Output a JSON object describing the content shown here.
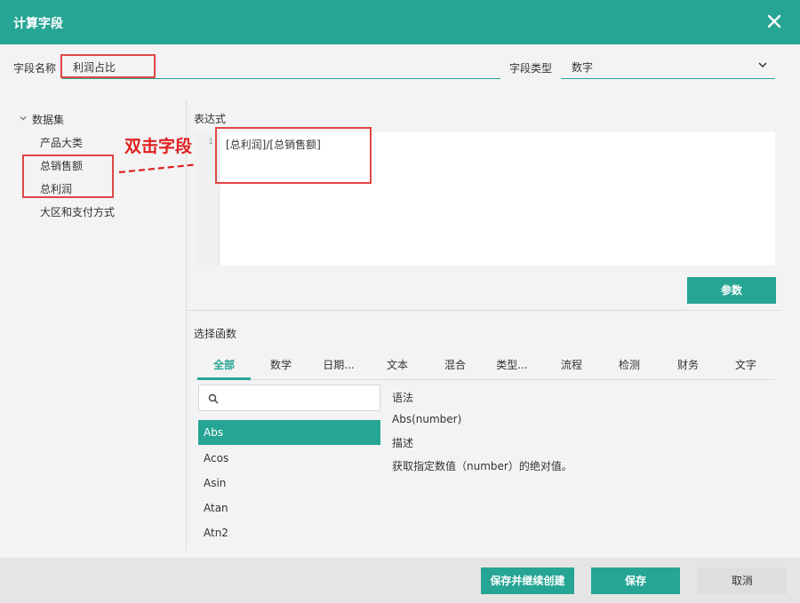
{
  "dialog": {
    "title": "计算字段"
  },
  "field": {
    "name_label": "字段名称",
    "name_value": "利润占比",
    "type_label": "字段类型",
    "type_value": "数字"
  },
  "tree": {
    "root": "数据集",
    "items": [
      "产品大类",
      "总销售额",
      "总利润",
      "大区和支付方式"
    ]
  },
  "annotation": {
    "text": "双击字段"
  },
  "expression": {
    "label": "表达式",
    "line_number": "1",
    "code": "[总利润]/[总销售额]"
  },
  "params_button": "参数",
  "functions": {
    "label": "选择函数",
    "tabs": [
      "全部",
      "数学",
      "日期...",
      "文本",
      "混合",
      "类型...",
      "流程",
      "检测",
      "财务",
      "文字"
    ],
    "search_placeholder": "",
    "list": [
      "Abs",
      "Acos",
      "Asin",
      "Atan",
      "Atn2"
    ],
    "selected": "Abs"
  },
  "description": {
    "syntax_label": "语法",
    "syntax": "Abs(number)",
    "desc_label": "描述",
    "desc": "获取指定数值（number）的绝对值。"
  },
  "footer": {
    "save_continue": "保存并继续创建",
    "save": "保存",
    "cancel": "取消"
  },
  "colors": {
    "accent": "#26a594",
    "annotation": "#e02020"
  }
}
